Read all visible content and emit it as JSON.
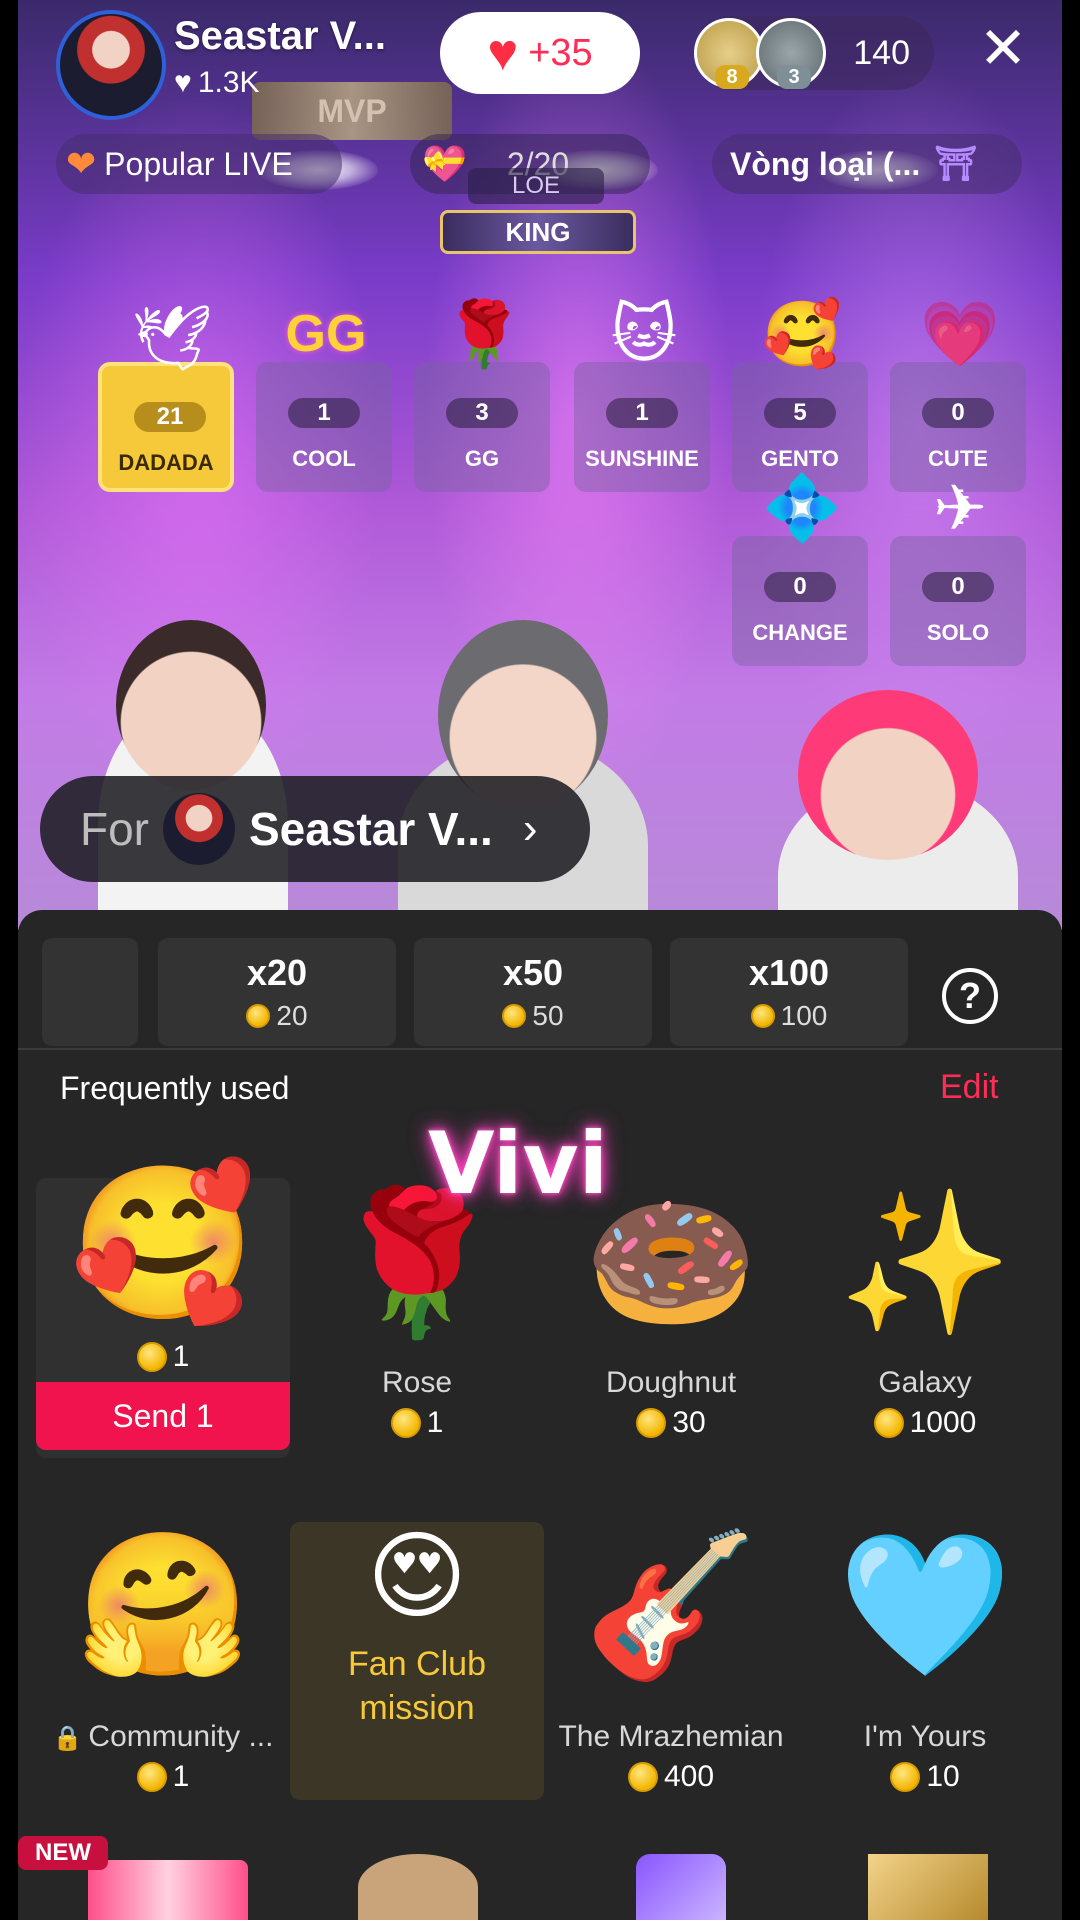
{
  "host": {
    "name": "Seastar V...",
    "likes": "1.3K",
    "badge": "MVP"
  },
  "likes_pill": {
    "count": "+35"
  },
  "viewers": {
    "badge1": "8",
    "badge2": "3",
    "count": "140"
  },
  "popular": {
    "label": "Popular LIVE"
  },
  "ranking": {
    "value": "2/20",
    "tag": "LOE",
    "title": "KING"
  },
  "round": {
    "label": "Vòng loại  (..."
  },
  "votes": [
    {
      "count": "21",
      "label": "DADADA",
      "icon": "wing-icon",
      "glyph": "🕊"
    },
    {
      "count": "1",
      "label": "COOL",
      "icon": "gg-icon",
      "glyph": "GG"
    },
    {
      "count": "3",
      "label": "GG",
      "icon": "rose-icon",
      "glyph": "🌹"
    },
    {
      "count": "1",
      "label": "SUNSHINE",
      "icon": "cat-icon",
      "glyph": "🐱"
    },
    {
      "count": "5",
      "label": "GENTO",
      "icon": "heart-hug-icon",
      "glyph": "🥰"
    },
    {
      "count": "0",
      "label": "CUTE",
      "icon": "heart-icon",
      "glyph": "💗"
    },
    {
      "count": "0",
      "label": "CHANGE",
      "icon": "planet-icon",
      "glyph": "💠"
    },
    {
      "count": "0",
      "label": "SOLO",
      "icon": "jet-icon",
      "glyph": "✈"
    }
  ],
  "for_pill": {
    "label": "For",
    "name": "Seastar V..."
  },
  "quantities": [
    {
      "label": "x20",
      "cost": "20"
    },
    {
      "label": "x50",
      "cost": "50"
    },
    {
      "label": "x100",
      "cost": "100"
    }
  ],
  "frequently_used": {
    "title": "Frequently used",
    "edit": "Edit"
  },
  "overlay_text": "Vivi",
  "gifts_row1": [
    {
      "name": "",
      "price": "1",
      "icon": "heart-hug-icon",
      "glyph": "🥰",
      "send": "Send 1"
    },
    {
      "name": "Rose",
      "price": "1",
      "icon": "rose-icon",
      "glyph": "🌹"
    },
    {
      "name": "Doughnut",
      "price": "30",
      "icon": "doughnut-icon",
      "glyph": "🍩"
    },
    {
      "name": "Galaxy",
      "price": "1000",
      "icon": "galaxy-icon",
      "glyph": "✨"
    }
  ],
  "gifts_row2": [
    {
      "name": "Community ...",
      "price": "1",
      "icon": "community-icon",
      "glyph": "🤗"
    },
    {
      "name": "Fan Club\nmission",
      "icon": "fanclub-heart-icon",
      "glyph": "😍"
    },
    {
      "name": "The Mrazhemian",
      "price": "400",
      "icon": "musician-icon",
      "glyph": "🎸"
    },
    {
      "name": "I'm Yours",
      "price": "10",
      "icon": "blue-heart-icon",
      "glyph": "🩵"
    }
  ],
  "new_badge": "NEW",
  "colors": {
    "accent": "#f0134d",
    "panel": "#262626",
    "gold": "#f6c93a"
  }
}
